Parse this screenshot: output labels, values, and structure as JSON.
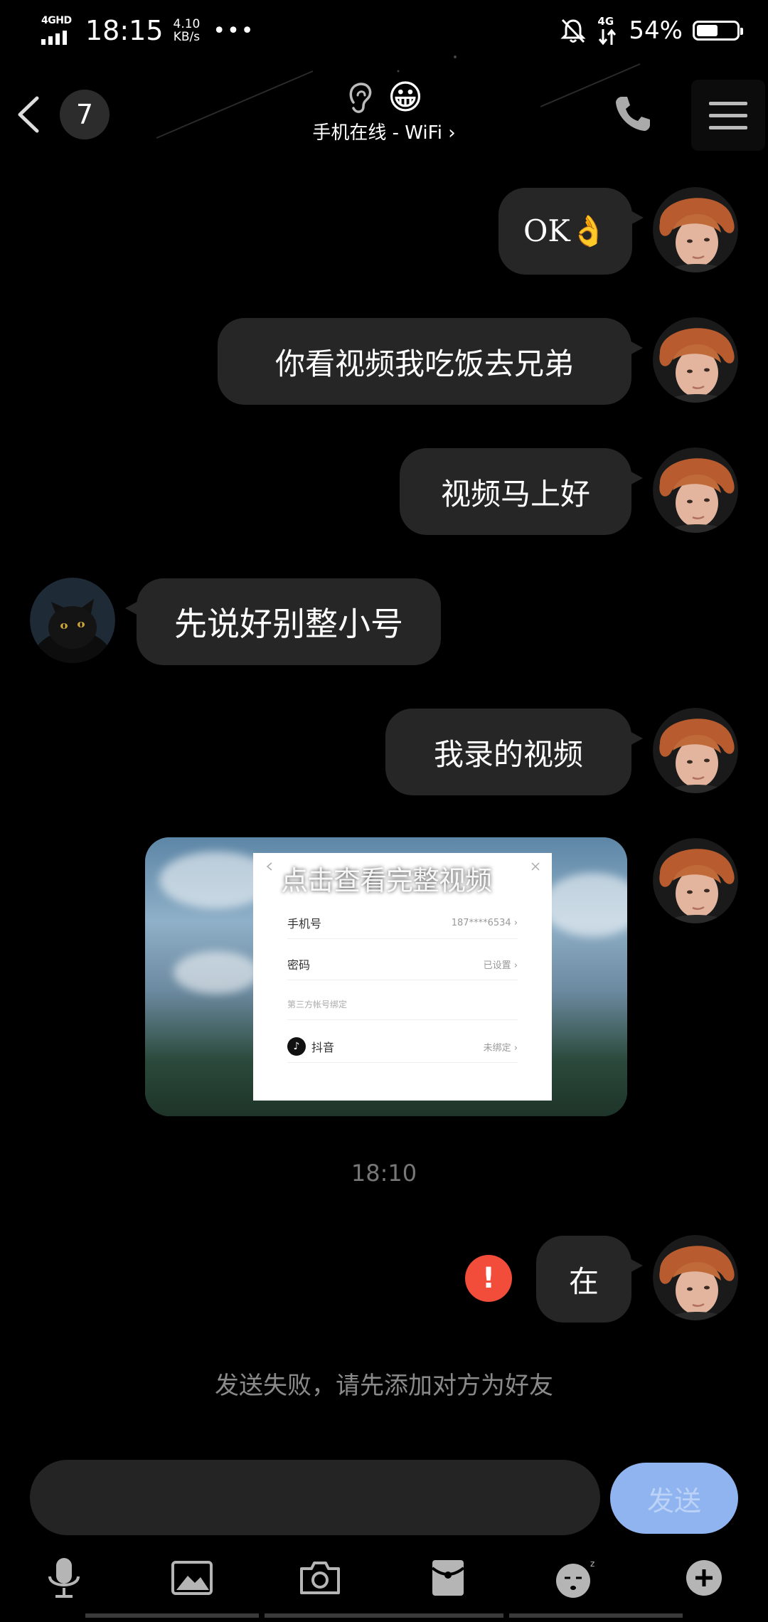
{
  "status_bar": {
    "network": "4GHD",
    "time": "18:15",
    "speed_value": "4.10",
    "speed_unit": "KB/s",
    "more": "•••",
    "network_right": "4G",
    "battery_percent": "54%",
    "battery_level": 0.54
  },
  "header": {
    "unread_count": "7",
    "title_emoji": "😀",
    "online_status": "手机在线 - WiFi ›"
  },
  "messages": [
    {
      "side": "right",
      "text": "OK👌"
    },
    {
      "side": "right",
      "text": "你看视频我吃饭去兄弟"
    },
    {
      "side": "right",
      "text": "视频马上好"
    },
    {
      "side": "left",
      "text": "先说好别整小号"
    },
    {
      "side": "right",
      "text": "我录的视频"
    }
  ],
  "video_message": {
    "caption": "点击查看完整视频",
    "rows": [
      {
        "label": "手机号",
        "value": "187****6534 ›"
      },
      {
        "label": "密码",
        "value": "已设置 ›"
      },
      {
        "label": "第三方帐号绑定",
        "value": ""
      },
      {
        "label": "抖音",
        "value": "未绑定 ›"
      }
    ]
  },
  "timestamp": "18:10",
  "failed_message": {
    "text": "在",
    "error_symbol": "!"
  },
  "system_note": "发送失败，请先添加对方为好友",
  "input": {
    "placeholder": "",
    "value": ""
  },
  "send_label": "发送",
  "toolbar": [
    "microphone-icon",
    "image-icon",
    "camera-icon",
    "red-packet-icon",
    "sticker-icon",
    "plus-icon"
  ],
  "colors": {
    "accent": "#8fb4f0",
    "bubble": "#262626",
    "error": "#f24d3b"
  }
}
